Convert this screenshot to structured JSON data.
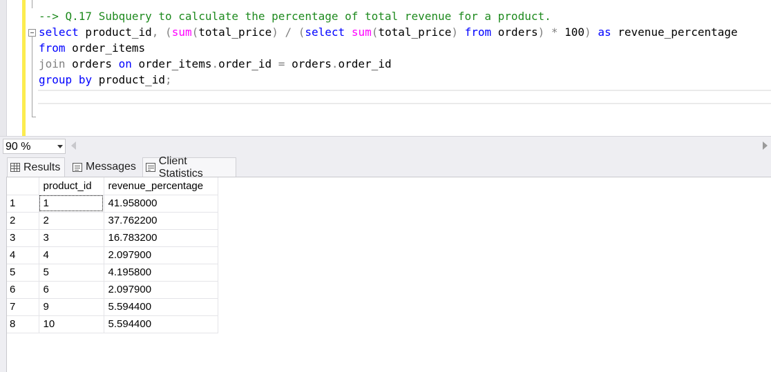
{
  "editor": {
    "lines": [
      [
        {
          "t": "--> Q.17 Subquery to calculate the percentage of total revenue for a product.",
          "c": "cm"
        }
      ],
      [
        {
          "t": "select",
          "c": "kw"
        },
        {
          "t": " product_id",
          "c": "id"
        },
        {
          "t": ",",
          "c": "op"
        },
        {
          "t": " ",
          "c": "id"
        },
        {
          "t": "(",
          "c": "op"
        },
        {
          "t": "sum",
          "c": "fn"
        },
        {
          "t": "(",
          "c": "op"
        },
        {
          "t": "total_price",
          "c": "id"
        },
        {
          "t": ")",
          "c": "op"
        },
        {
          "t": " / ",
          "c": "op"
        },
        {
          "t": "(",
          "c": "op"
        },
        {
          "t": "select",
          "c": "kw"
        },
        {
          "t": " ",
          "c": "id"
        },
        {
          "t": "sum",
          "c": "fn"
        },
        {
          "t": "(",
          "c": "op"
        },
        {
          "t": "total_price",
          "c": "id"
        },
        {
          "t": ")",
          "c": "op"
        },
        {
          "t": " ",
          "c": "id"
        },
        {
          "t": "from",
          "c": "kw"
        },
        {
          "t": " orders",
          "c": "id"
        },
        {
          "t": ")",
          "c": "op"
        },
        {
          "t": " * ",
          "c": "op"
        },
        {
          "t": "100",
          "c": "id"
        },
        {
          "t": ")",
          "c": "op"
        },
        {
          "t": " ",
          "c": "id"
        },
        {
          "t": "as",
          "c": "kw"
        },
        {
          "t": " revenue_percentage",
          "c": "id"
        }
      ],
      [
        {
          "t": "from",
          "c": "kw"
        },
        {
          "t": " order_items",
          "c": "id"
        }
      ],
      [
        {
          "t": "join",
          "c": "op"
        },
        {
          "t": " orders ",
          "c": "id"
        },
        {
          "t": "on",
          "c": "kw"
        },
        {
          "t": " order_items",
          "c": "id"
        },
        {
          "t": ".",
          "c": "op"
        },
        {
          "t": "order_id ",
          "c": "id"
        },
        {
          "t": "=",
          "c": "op"
        },
        {
          "t": " orders",
          "c": "id"
        },
        {
          "t": ".",
          "c": "op"
        },
        {
          "t": "order_id",
          "c": "id"
        }
      ],
      [
        {
          "t": "group",
          "c": "kw"
        },
        {
          "t": " ",
          "c": "id"
        },
        {
          "t": "by",
          "c": "kw"
        },
        {
          "t": " product_id",
          "c": "id"
        },
        {
          "t": ";",
          "c": "op"
        }
      ]
    ]
  },
  "zoom": {
    "value": "90 %"
  },
  "tabs": {
    "results": "Results",
    "messages": "Messages",
    "client_statistics": "Client Statistics"
  },
  "results": {
    "columns": [
      "product_id",
      "revenue_percentage"
    ],
    "rows": [
      {
        "n": "1",
        "product_id": "1",
        "revenue_percentage": "41.958000"
      },
      {
        "n": "2",
        "product_id": "2",
        "revenue_percentage": "37.762200"
      },
      {
        "n": "3",
        "product_id": "3",
        "revenue_percentage": "16.783200"
      },
      {
        "n": "4",
        "product_id": "4",
        "revenue_percentage": "2.097900"
      },
      {
        "n": "5",
        "product_id": "5",
        "revenue_percentage": "4.195800"
      },
      {
        "n": "6",
        "product_id": "6",
        "revenue_percentage": "2.097900"
      },
      {
        "n": "7",
        "product_id": "9",
        "revenue_percentage": "5.594400"
      },
      {
        "n": "8",
        "product_id": "10",
        "revenue_percentage": "5.594400"
      }
    ]
  }
}
